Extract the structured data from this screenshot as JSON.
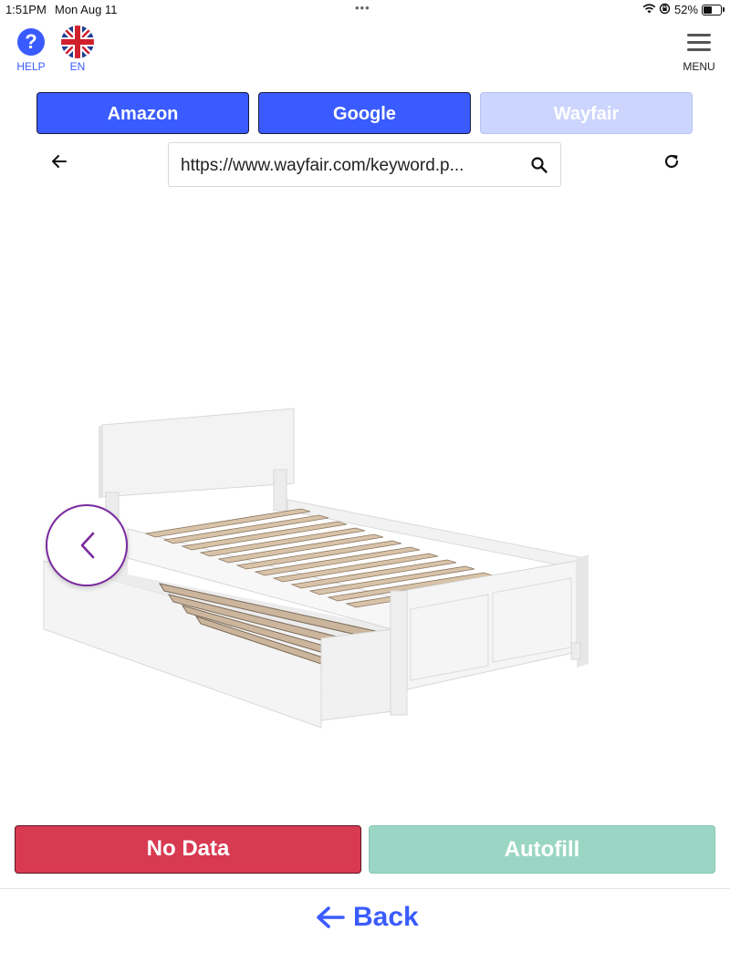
{
  "status_bar": {
    "time": "1:51PM",
    "date": "Mon Aug 11",
    "battery_percent": "52%",
    "battery_level": 0.52
  },
  "header": {
    "help_label": "HELP",
    "language_label": "EN",
    "menu_label": "MENU"
  },
  "tabs": [
    {
      "label": "Amazon",
      "state": "active"
    },
    {
      "label": "Google",
      "state": "active"
    },
    {
      "label": "Wayfair",
      "state": "disabled"
    }
  ],
  "browser": {
    "url": "https://www.wayfair.com/keyword.p..."
  },
  "product": {
    "image_subject": "white twin bed frame with trundle"
  },
  "actions": {
    "no_data_label": "No Data",
    "autofill_label": "Autofill",
    "back_label": "Back"
  },
  "colors": {
    "primary": "#3a5bff",
    "tab_disabled": "#ccd5fd",
    "no_data": "#d83a52",
    "autofill": "#9ad6c3",
    "carousel_accent": "#7a2a9e"
  }
}
